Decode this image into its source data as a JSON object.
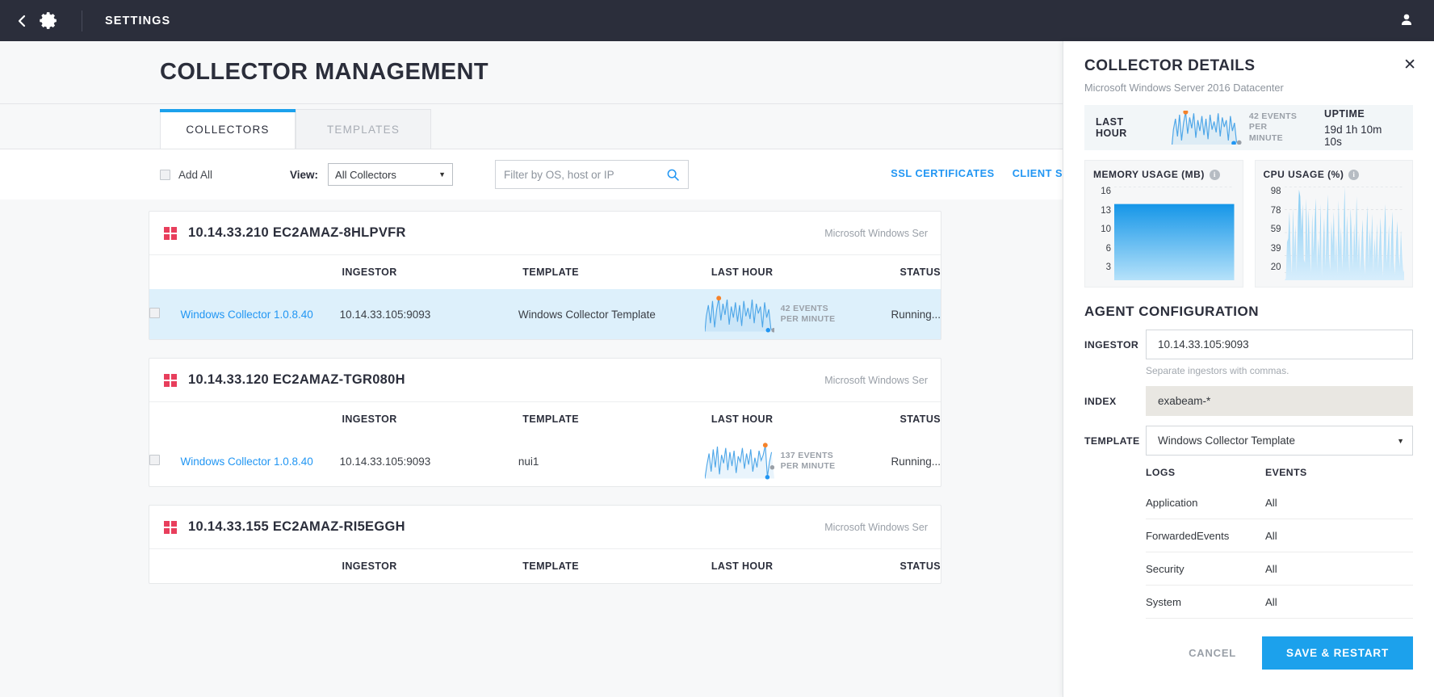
{
  "topbar": {
    "back_icon": "chevron-left-icon",
    "gear_icon": "gear-icon",
    "title": "SETTINGS",
    "user_icon": "user-icon"
  },
  "page": {
    "title": "COLLECTOR MANAGEMENT"
  },
  "tabs": [
    {
      "label": "COLLECTORS",
      "active": true
    },
    {
      "label": "TEMPLATES",
      "active": false
    }
  ],
  "toolbar": {
    "add_all_label": "Add All",
    "add_all_checked": false,
    "view_label": "View:",
    "view_value": "All Collectors",
    "view_options": [
      "All Collectors"
    ],
    "filter_placeholder": "Filter by OS, host or IP",
    "filter_value": "",
    "search_icon": "search-icon",
    "links": [
      {
        "label": "SSL CERTIFICATES"
      },
      {
        "label": "CLIENT S"
      }
    ]
  },
  "table_headers": [
    "",
    "",
    "INGESTOR",
    "TEMPLATE",
    "LAST HOUR",
    "STATUS"
  ],
  "groups": [
    {
      "icon": "windows-logo-icon",
      "title": "10.14.33.210 EC2AMAZ-8HLPVFR",
      "os": "Microsoft Windows Ser",
      "rows": [
        {
          "checked": false,
          "name": "Windows Collector 1.0.8.40",
          "ingestor": "10.14.33.105:9093",
          "template": "Windows Collector Template",
          "events_count": "42 EVENTS",
          "events_unit": "PER MINUTE",
          "status": "Running...",
          "selected": true
        }
      ]
    },
    {
      "icon": "windows-logo-icon",
      "title": "10.14.33.120 EC2AMAZ-TGR080H",
      "os": "Microsoft Windows Ser",
      "rows": [
        {
          "checked": false,
          "name": "Windows Collector 1.0.8.40",
          "ingestor": "10.14.33.105:9093",
          "template": "nui1",
          "events_count": "137 EVENTS",
          "events_unit": "PER MINUTE",
          "status": "Running...",
          "selected": false
        }
      ]
    },
    {
      "icon": "windows-logo-icon",
      "title": "10.14.33.155 EC2AMAZ-RI5EGGH",
      "os": "Microsoft Windows Ser",
      "rows": []
    }
  ],
  "panel": {
    "title": "COLLECTOR DETAILS",
    "subtitle": "Microsoft Windows Server 2016 Datacenter",
    "close_icon": "close-icon",
    "last_hour_label": "LAST HOUR",
    "events_count": "42 EVENTS",
    "events_unit": "PER MINUTE",
    "uptime_label": "UPTIME",
    "uptime_value": "19d 1h 10m 10s",
    "memory": {
      "title": "MEMORY USAGE (MB)",
      "info_icon": "info-icon",
      "ticks": [
        "16",
        "13",
        "10",
        "6",
        "3"
      ]
    },
    "cpu": {
      "title": "CPU USAGE (%)",
      "info_icon": "info-icon",
      "ticks": [
        "98",
        "78",
        "59",
        "39",
        "20"
      ]
    },
    "agent_config_title": "AGENT CONFIGURATION",
    "ingestor_label": "INGESTOR",
    "ingestor_value": "10.14.33.105:9093",
    "ingestor_hint": "Separate ingestors with commas.",
    "index_label": "INDEX",
    "index_value": "exabeam-*",
    "template_label": "TEMPLATE",
    "template_value": "Windows Collector Template",
    "template_caret_icon": "chevron-down-icon",
    "logs_header": "LOGS",
    "events_header": "EVENTS",
    "logs": [
      {
        "name": "Application",
        "events": "All"
      },
      {
        "name": "ForwardedEvents",
        "events": "All"
      },
      {
        "name": "Security",
        "events": "All"
      },
      {
        "name": "System",
        "events": "All"
      }
    ],
    "cancel_label": "CANCEL",
    "save_label": "SAVE & RESTART"
  },
  "colors": {
    "accent": "#1ca1ec",
    "link": "#2196f3",
    "topbar_bg": "#2b2e3b",
    "windows_red": "#e83e5c",
    "selected_row": "#ddf0fb",
    "spark_line": "#4da6e8",
    "marker_high": "#f5822a",
    "marker_low": "#2196f3",
    "marker_end": "#9aa0a8"
  },
  "chart_data": [
    {
      "type": "line",
      "title": "LAST HOUR",
      "ylabel": "events per minute",
      "annotation": "42 EVENTS PER MINUTE",
      "values": [
        22,
        46,
        14,
        52,
        26,
        8,
        40,
        20,
        58,
        34,
        10,
        62,
        44,
        18,
        54,
        12,
        48,
        30,
        6,
        56,
        24,
        38,
        16,
        50,
        28,
        60,
        20,
        42,
        10,
        52,
        32,
        14,
        46,
        26,
        58,
        18,
        40,
        8,
        54,
        30,
        22,
        48,
        12,
        60,
        36,
        16,
        44,
        24,
        56,
        28,
        10,
        50,
        34,
        18,
        52,
        20,
        42,
        14,
        46,
        26,
        38,
        8,
        58,
        32,
        12,
        48,
        22,
        54,
        16,
        40,
        28,
        60,
        18,
        44,
        10,
        50,
        30,
        24,
        56,
        20,
        46,
        14,
        38,
        26,
        52,
        12,
        42,
        34,
        18,
        48,
        8,
        58,
        22,
        40,
        28,
        16,
        54,
        30,
        12,
        5
      ],
      "markers": {
        "max_index": 30,
        "min_index": 93
      }
    },
    {
      "type": "area",
      "title": "MEMORY USAGE (MB)",
      "ylabel": "MB",
      "ytick_labels": [
        "16",
        "13",
        "10",
        "6",
        "3"
      ],
      "ylim": [
        0,
        16
      ],
      "values": [
        13.4,
        13.4,
        13.4,
        13.4,
        13.4,
        13.4,
        13.4,
        13.4,
        13.4,
        13.4,
        13.4,
        13.4,
        13.4,
        13.4,
        13.4,
        13.4,
        13.4,
        13.4,
        13.4,
        13.4
      ],
      "grid": true
    },
    {
      "type": "area",
      "title": "CPU USAGE (%)",
      "ylabel": "%",
      "ytick_labels": [
        "98",
        "78",
        "59",
        "39",
        "20"
      ],
      "ylim": [
        0,
        98
      ],
      "values": [
        2,
        40,
        44,
        72,
        30,
        6,
        76,
        26,
        58,
        8,
        62,
        95,
        88,
        52,
        80,
        22,
        18,
        86,
        30,
        74,
        34,
        8,
        70,
        28,
        60,
        86,
        12,
        44,
        24,
        80,
        4,
        38,
        66,
        14,
        52,
        90,
        26,
        10,
        62,
        36,
        72,
        18,
        48,
        6,
        84,
        30,
        56,
        12,
        40,
        98,
        22,
        68,
        34,
        8,
        76,
        46,
        14,
        60,
        28,
        88,
        18,
        50,
        10,
        36,
        64,
        24,
        6,
        42,
        78,
        16,
        54,
        30,
        70,
        8,
        44,
        22,
        60,
        12,
        38,
        66,
        26,
        4,
        50,
        80,
        18,
        34,
        58,
        10,
        46,
        72,
        20,
        6,
        40,
        62,
        28,
        14,
        52,
        24,
        8,
        12
      ],
      "grid": true
    }
  ]
}
